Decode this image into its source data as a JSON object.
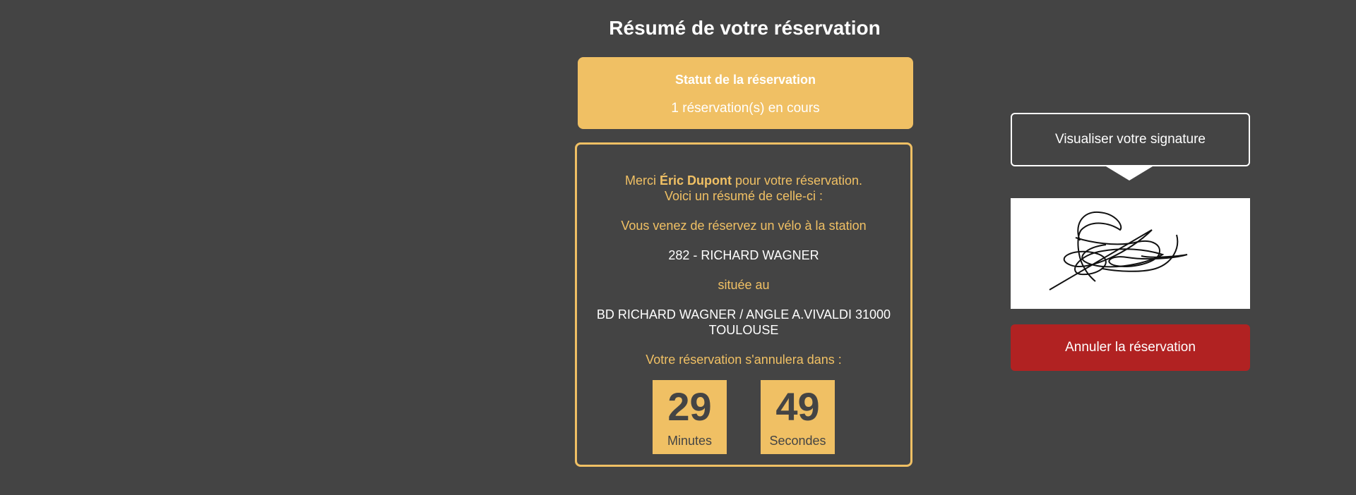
{
  "summary": {
    "title": "Résumé de votre réservation",
    "status_title": "Statut de la réservation",
    "status_text": "1 réservation(s) en cours",
    "thanks_prefix": "Merci ",
    "user_name": "Éric Dupont",
    "thanks_suffix": " pour votre réservation.",
    "summary_intro": "Voici un résumé de celle-ci :",
    "station_intro": "Vous venez de réservez un vélo à la station",
    "station": "282 - RICHARD WAGNER",
    "located_label": "située au",
    "address": "BD RICHARD WAGNER / ANGLE A.VIVALDI 31000 TOULOUSE",
    "expire_label": "Votre réservation s'annulera dans :",
    "countdown": {
      "minutes": "29",
      "minutes_label": "Minutes",
      "seconds": "49",
      "seconds_label": "Secondes"
    }
  },
  "signature": {
    "view_button": "Visualiser votre signature",
    "image": "handwritten-signature"
  },
  "actions": {
    "cancel": "Annuler la réservation"
  },
  "colors": {
    "background": "#444444",
    "accent": "#f0c064",
    "danger": "#b12222"
  }
}
